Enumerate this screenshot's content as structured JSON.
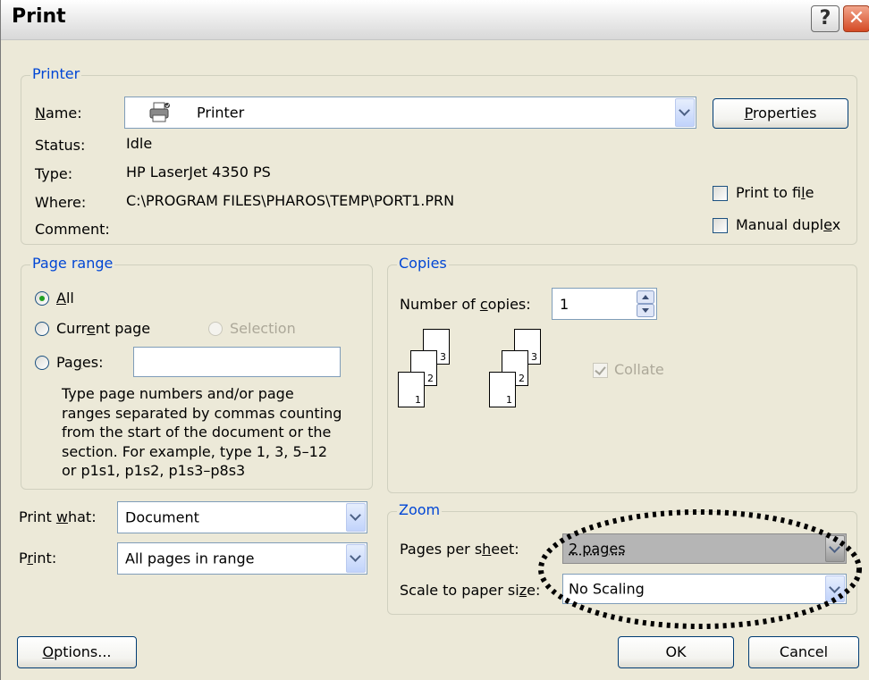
{
  "dialog": {
    "title": "Print",
    "help_glyph": "?",
    "close_glyph": "✕"
  },
  "printer": {
    "legend": "Printer",
    "name_label_pre": "",
    "name_label_u": "N",
    "name_label_post": "ame:",
    "name_value": "Printer",
    "status_label": "Status:",
    "status_value": "Idle",
    "type_label": "Type:",
    "type_value": "HP LaserJet 4350 PS",
    "where_label": "Where:",
    "where_value": "C:\\PROGRAM FILES\\PHAROS\\TEMP\\PORT1.PRN",
    "comment_label": "Comment:",
    "properties_pre": "",
    "properties_u": "P",
    "properties_post": "roperties",
    "print_to_file_pre": "Print to fi",
    "print_to_file_u": "l",
    "print_to_file_post": "e",
    "manual_duplex_pre": "Manual dupl",
    "manual_duplex_u": "e",
    "manual_duplex_post": "x"
  },
  "page_range": {
    "legend": "Page range",
    "all_pre": "",
    "all_u": "A",
    "all_post": "ll",
    "current_pre": "Curr",
    "current_u": "e",
    "current_post": "nt page",
    "selection": "Selection",
    "pages_pre": "Pa",
    "pages_u": "g",
    "pages_post": "es:",
    "pages_value": "",
    "help_lines": [
      "Type page numbers and/or page",
      "ranges separated by commas counting",
      "from the start of the document or the",
      "section. For example, type 1, 3, 5–12",
      "or p1s1, p1s2, p1s3–p8s3"
    ]
  },
  "copies": {
    "legend": "Copies",
    "number_pre": "Number of ",
    "number_u": "c",
    "number_post": "opies:",
    "number_value": "1",
    "collate": "Collate",
    "collate_checked": true,
    "page_numbers": [
      "3",
      "2",
      "1"
    ]
  },
  "print_options": {
    "print_what_pre": "Print ",
    "print_what_u": "w",
    "print_what_post": "hat:",
    "print_what_value": "Document",
    "print_pre": "P",
    "print_u": "r",
    "print_post": "int:",
    "print_value": "All pages in range"
  },
  "zoom": {
    "legend": "Zoom",
    "pages_per_sheet_pre": "Pages per s",
    "pages_per_sheet_u": "h",
    "pages_per_sheet_post": "eet:",
    "pages_per_sheet_value": "2 pages",
    "scale_pre": "Scale to paper si",
    "scale_u": "z",
    "scale_post": "e:",
    "scale_value": "No Scaling"
  },
  "footer": {
    "options_pre": "",
    "options_u": "O",
    "options_post": "ptions...",
    "ok": "OK",
    "cancel": "Cancel"
  },
  "colors": {
    "legend_text": "#0046d5",
    "dialog_bg": "#ece9d8",
    "annotation": "#000000",
    "highlight_field": "#b5b5b5"
  },
  "icons": [
    "printer-icon",
    "help-icon",
    "close-icon",
    "dropdown-arrow-icon",
    "spinner-icon",
    "collate-pages-icon"
  ]
}
